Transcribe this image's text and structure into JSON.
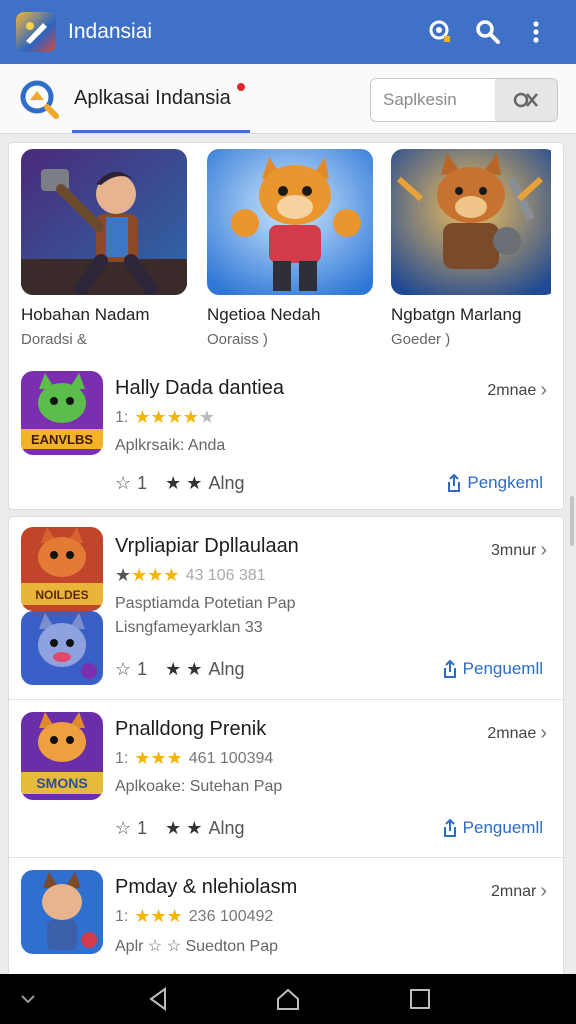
{
  "app": {
    "title": "Indansiai"
  },
  "header": {
    "section_title": "Aplkasai Indansia",
    "search_placeholder": "Saplkesin",
    "search_value": ""
  },
  "featured": [
    {
      "name": "Hobahan Nadam",
      "sub": "Doradsi &"
    },
    {
      "name": "Ngetioa Nedah",
      "sub": "Ooraiss )"
    },
    {
      "name": "Ngbatgn Marlang",
      "sub": "Goeder )"
    }
  ],
  "card1_item": {
    "title": "Hally Dada dantiea",
    "rating_prefix": "1:",
    "meta2": "Aplkrsaik:  Anda",
    "time": "2mnae",
    "foot_count": "1",
    "foot_label": "Alng",
    "install_label": "Pengkeml"
  },
  "list": [
    {
      "title": "Vrpliapiar Dpllaulaan",
      "rating_suffix": "43 106 381",
      "meta2": "Pasptiamda Potetian Pap",
      "meta3": "Lisngfameyarklan  33",
      "time": "3mnur",
      "foot_count": "1",
      "foot_label": "Alng",
      "install_label": "Penguemll"
    },
    {
      "title": "Pnalldong Prenik",
      "rating_prefix": "1:",
      "rating_suffix": "461 100394",
      "meta2": "Aplkoake:  Sutehan Pap",
      "time": "2mnae",
      "foot_count": "1",
      "foot_label": "Alng",
      "install_label": "Penguemll"
    },
    {
      "title": "Pmday & nlehiolasm",
      "rating_prefix": "1:",
      "rating_suffix": "236 100492",
      "meta2": "Aplr ☆ ☆  Suedton Pap",
      "time": "2mnar"
    }
  ],
  "icon_badges": {
    "game1": "EANVLBS",
    "game2": "NOILDES",
    "game3": "SMONS"
  },
  "colors": {
    "appbar": "#3f72c6",
    "accent": "#2c6cc7",
    "star": "#f4b400"
  }
}
